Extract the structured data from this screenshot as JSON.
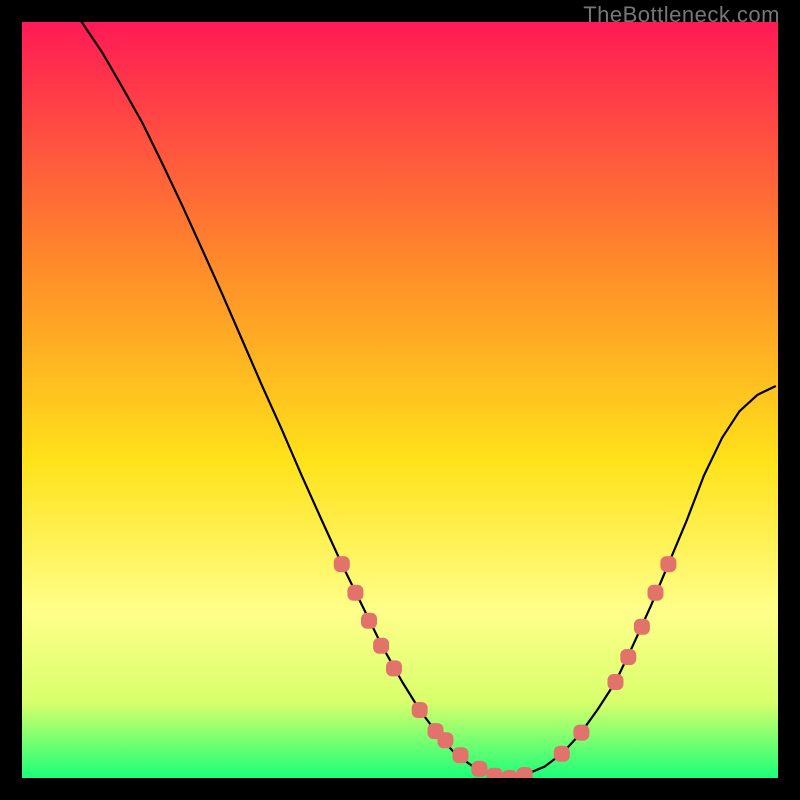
{
  "watermark": "TheBottleneck.com",
  "colors": {
    "black": "#000000",
    "stroke": "#000000",
    "marker": "#e1736b",
    "grad_top": "#ff1a55",
    "grad_orange": "#ff8a2a",
    "grad_yellow": "#ffe21a",
    "grad_pale_yellow": "#ffff8a",
    "grad_lime": "#d8ff6b",
    "grad_green": "#1aff78"
  },
  "chart_data": {
    "type": "line",
    "title": "",
    "xlabel": "",
    "ylabel": "",
    "xlim": [
      0,
      100
    ],
    "ylim": [
      0,
      100
    ],
    "x": [
      7.9,
      10.6,
      13.2,
      15.9,
      18.5,
      21.2,
      23.8,
      26.5,
      29.1,
      31.7,
      34.4,
      37.0,
      39.7,
      42.3,
      45.0,
      47.6,
      50.3,
      52.6,
      55.0,
      57.3,
      59.7,
      62.0,
      64.4,
      66.7,
      69.1,
      71.4,
      73.8,
      76.1,
      78.5,
      80.8,
      83.2,
      85.5,
      87.9,
      90.2,
      92.6,
      94.9,
      97.3,
      99.6
    ],
    "values": [
      100.0,
      96.0,
      91.5,
      86.7,
      81.4,
      75.7,
      70.0,
      64.0,
      58.0,
      52.0,
      46.0,
      40.0,
      34.0,
      28.3,
      22.8,
      17.5,
      12.7,
      9.0,
      5.8,
      3.2,
      1.5,
      0.5,
      0.0,
      0.5,
      1.5,
      3.2,
      5.8,
      9.0,
      12.7,
      17.5,
      22.8,
      28.3,
      34.0,
      40.0,
      45.0,
      48.5,
      50.7,
      51.8
    ],
    "marker_points": [
      {
        "x": 42.3,
        "y": 28.3
      },
      {
        "x": 44.1,
        "y": 24.5
      },
      {
        "x": 45.9,
        "y": 20.8
      },
      {
        "x": 47.5,
        "y": 17.5
      },
      {
        "x": 49.2,
        "y": 14.5
      },
      {
        "x": 52.6,
        "y": 9.0
      },
      {
        "x": 54.7,
        "y": 6.2
      },
      {
        "x": 56.0,
        "y": 5.0
      },
      {
        "x": 58.0,
        "y": 3.0
      },
      {
        "x": 60.5,
        "y": 1.2
      },
      {
        "x": 62.5,
        "y": 0.3
      },
      {
        "x": 64.5,
        "y": 0.0
      },
      {
        "x": 66.5,
        "y": 0.4
      },
      {
        "x": 71.4,
        "y": 3.2
      },
      {
        "x": 74.0,
        "y": 6.0
      },
      {
        "x": 78.5,
        "y": 12.7
      },
      {
        "x": 80.2,
        "y": 16.0
      },
      {
        "x": 82.0,
        "y": 20.0
      },
      {
        "x": 83.8,
        "y": 24.5
      },
      {
        "x": 85.5,
        "y": 28.3
      }
    ]
  }
}
